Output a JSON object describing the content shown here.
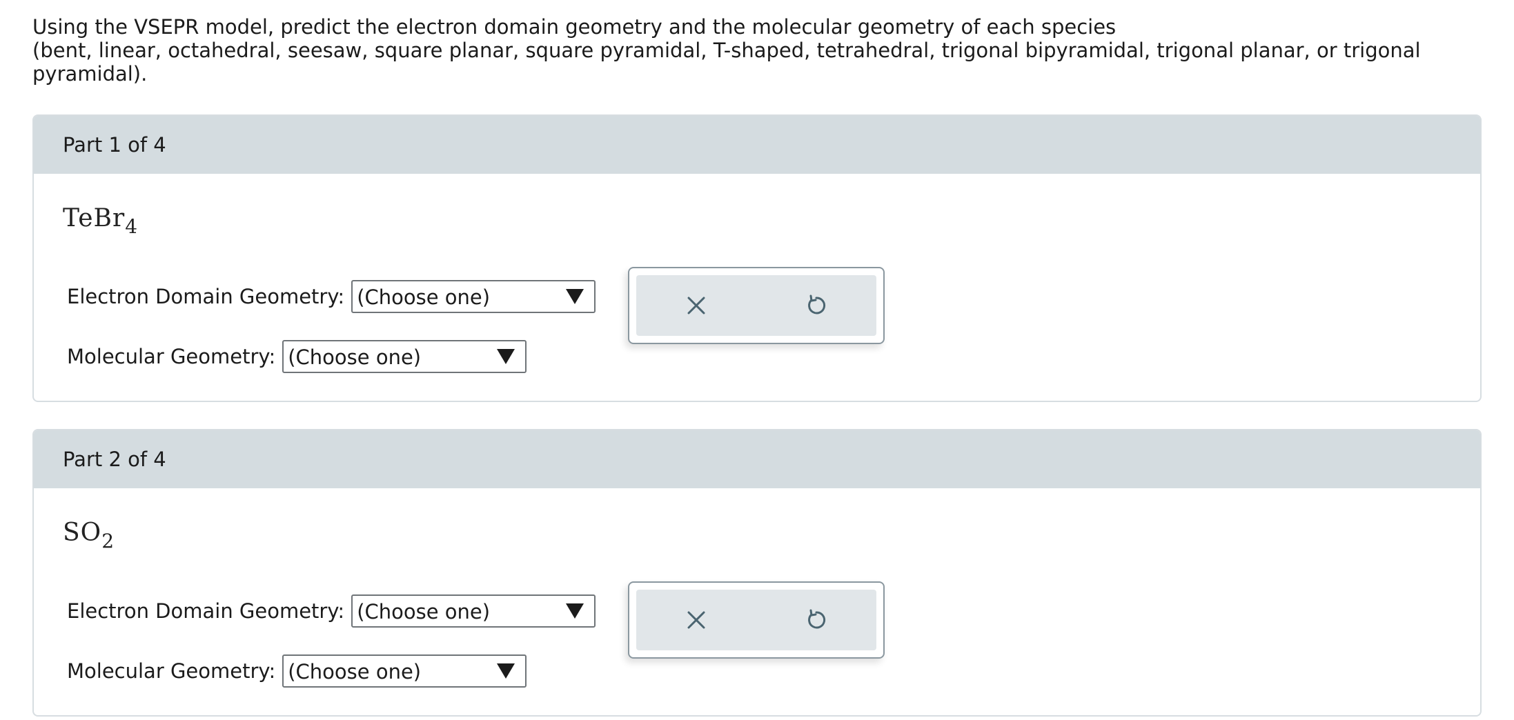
{
  "prompt": {
    "line1": "Using the VSEPR model, predict the electron domain geometry and the molecular geometry of each species",
    "line2": "(bent, linear, octahedral, seesaw, square planar, square pyramidal, T-shaped, tetrahedral, trigonal bipyramidal, trigonal planar, or trigonal pyramidal)."
  },
  "parts": [
    {
      "header": "Part 1 of 4",
      "formula_main": "TeBr",
      "formula_sub": "4",
      "edg_label": "Electron Domain Geometry:",
      "edg_value": "(Choose one)",
      "mg_label": "Molecular Geometry:",
      "mg_value": "(Choose one)",
      "clear_icon": "x-icon",
      "reset_icon": "undo-icon"
    },
    {
      "header": "Part 2 of 4",
      "formula_main": "SO",
      "formula_sub": "2",
      "edg_label": "Electron Domain Geometry:",
      "edg_value": "(Choose one)",
      "mg_label": "Molecular Geometry:",
      "mg_value": "(Choose one)",
      "clear_icon": "x-icon",
      "reset_icon": "undo-icon"
    }
  ],
  "colors": {
    "header_bg": "#d4dce0",
    "icon_color": "#4a6470",
    "action_bg": "#e1e6e9"
  }
}
